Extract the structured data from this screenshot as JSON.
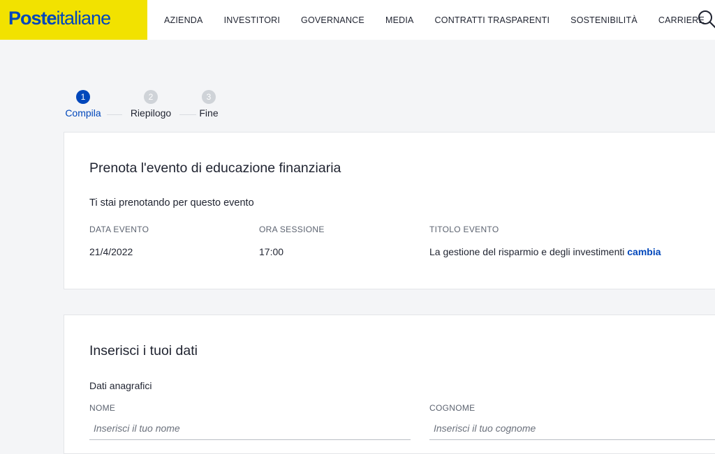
{
  "header": {
    "logo": {
      "part1": "Poste",
      "part2": "italiane"
    },
    "nav": [
      "AZIENDA",
      "INVESTITORI",
      "GOVERNANCE",
      "MEDIA",
      "CONTRATTI TRASPARENTI",
      "SOSTENIBILITÀ",
      "CARRIERE"
    ],
    "search_icon": "search-icon"
  },
  "stepper": {
    "steps": [
      {
        "number": "1",
        "label": "Compila",
        "state": "active"
      },
      {
        "number": "2",
        "label": "Riepilogo",
        "state": "inactive"
      },
      {
        "number": "3",
        "label": "Fine",
        "state": "inactive"
      }
    ]
  },
  "event_card": {
    "title": "Prenota l'evento di educazione finanziaria",
    "subtitle": "Ti stai prenotando per questo evento",
    "columns": [
      {
        "label": "DATA EVENTO",
        "value": "21/4/2022"
      },
      {
        "label": "ORA SESSIONE",
        "value": "17:00"
      },
      {
        "label": "TITOLO EVENTO",
        "value": "La gestione del risparmio e degli investimenti",
        "link": "cambia"
      }
    ]
  },
  "data_card": {
    "title": "Inserisci i tuoi dati",
    "section": "Dati anagrafici",
    "fields": [
      {
        "label": "NOME",
        "placeholder": "Inserisci il tuo nome",
        "value": ""
      },
      {
        "label": "COGNOME",
        "placeholder": "Inserisci il tuo cognome",
        "value": ""
      }
    ]
  },
  "colors": {
    "brand_yellow": "#f2e200",
    "brand_blue": "#0047bb",
    "background": "#f4f5f7"
  }
}
